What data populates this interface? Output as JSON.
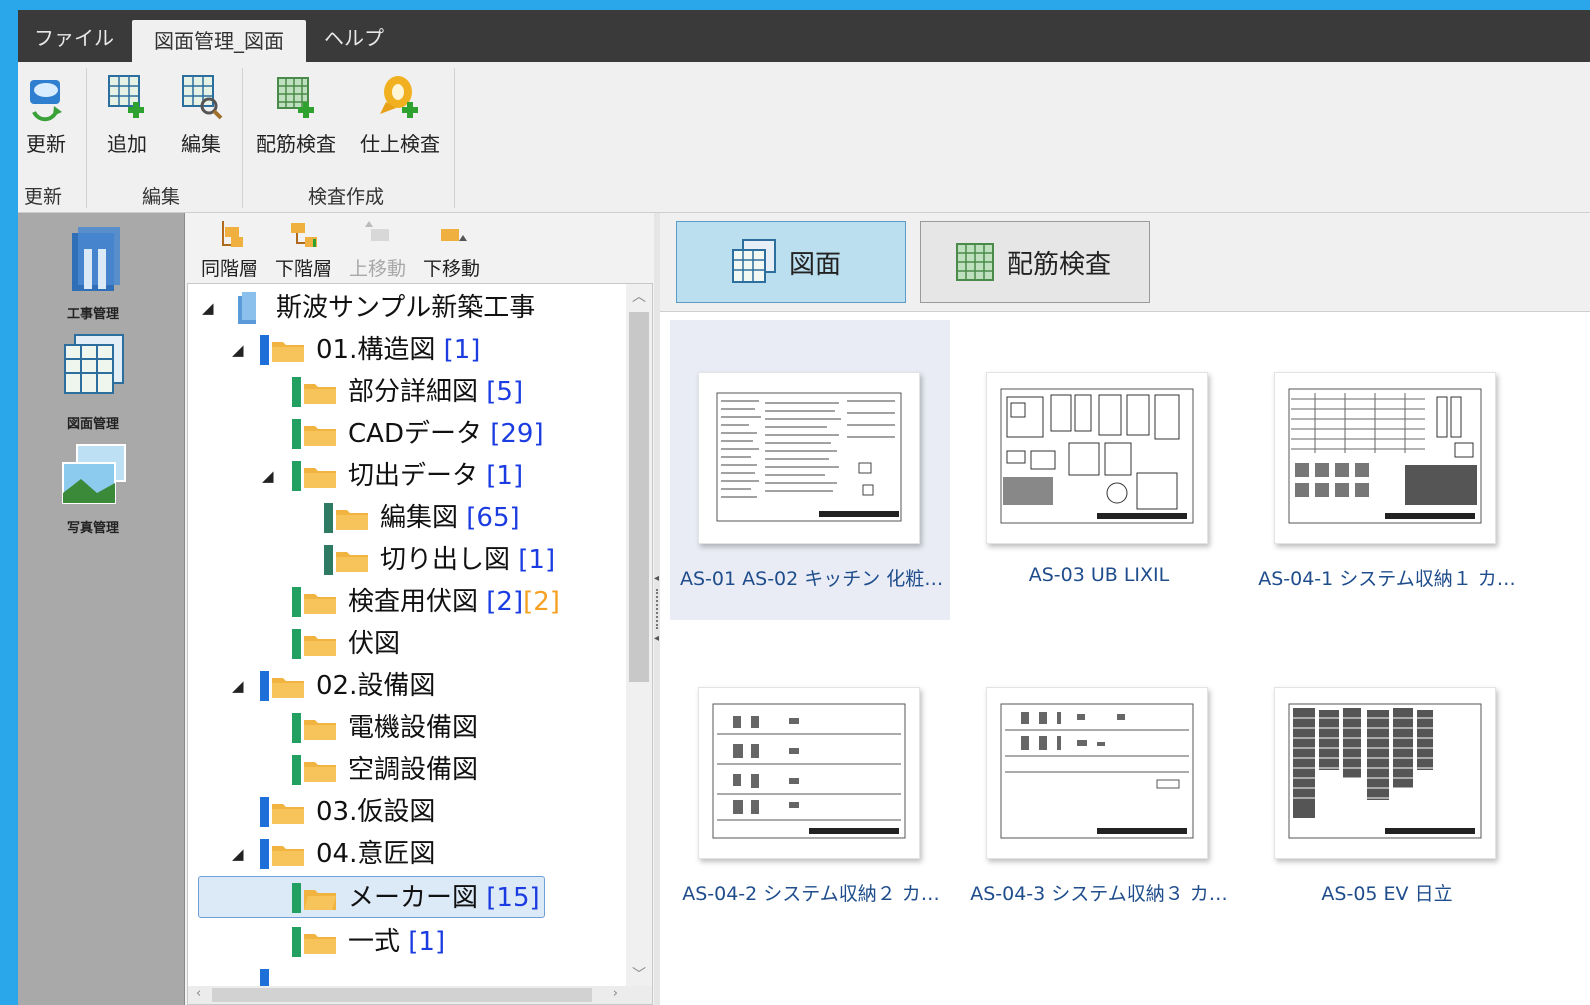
{
  "menu": {
    "items": [
      {
        "label": "ファイル",
        "active": false
      },
      {
        "label": "図面管理_図面",
        "active": true
      },
      {
        "label": "ヘルプ",
        "active": false
      }
    ]
  },
  "ribbon": {
    "buttons": {
      "refresh": "更新",
      "add": "追加",
      "edit": "編集",
      "rebar_inspection": "配筋検査",
      "finish_inspection": "仕上検査"
    },
    "groups": {
      "refresh": "更新",
      "edit": "編集",
      "inspection_create": "検査作成"
    }
  },
  "leftnav": {
    "items": [
      {
        "label": "工事管理",
        "icon": "construction-binder-icon"
      },
      {
        "label": "図面管理",
        "icon": "drawings-icon"
      },
      {
        "label": "写真管理",
        "icon": "photos-icon"
      }
    ]
  },
  "tree_toolbar": {
    "same_level": "同階層",
    "lower_level": "下階層",
    "move_up": "上移動",
    "move_down": "下移動"
  },
  "tree": {
    "root": "斯波サンプル新築工事",
    "nodes": [
      {
        "label": "01.構造図",
        "count": "[1]",
        "count2": ""
      },
      {
        "label": "部分詳細図",
        "count": "[5]",
        "count2": ""
      },
      {
        "label": "CADデータ",
        "count": "[29]",
        "count2": ""
      },
      {
        "label": "切出データ",
        "count": "[1]",
        "count2": ""
      },
      {
        "label": "編集図",
        "count": "[65]",
        "count2": ""
      },
      {
        "label": "切り出し図",
        "count": "[1]",
        "count2": ""
      },
      {
        "label": "検査用伏図",
        "count": "[2]",
        "count2": "[2]"
      },
      {
        "label": "伏図",
        "count": "",
        "count2": ""
      },
      {
        "label": "02.設備図",
        "count": "",
        "count2": ""
      },
      {
        "label": "電機設備図",
        "count": "",
        "count2": ""
      },
      {
        "label": "空調設備図",
        "count": "",
        "count2": ""
      },
      {
        "label": "03.仮設図",
        "count": "",
        "count2": ""
      },
      {
        "label": "04.意匠図",
        "count": "",
        "count2": ""
      },
      {
        "label": "メーカー図",
        "count": "[15]",
        "count2": ""
      },
      {
        "label": "一式",
        "count": "[1]",
        "count2": ""
      }
    ]
  },
  "content_tabs": {
    "drawings": "図面",
    "rebar_inspection": "配筋検査"
  },
  "drawings": [
    {
      "caption": "AS-01 AS-02 キッチン 化粧…"
    },
    {
      "caption": "AS-03 UB  LIXIL"
    },
    {
      "caption": "AS-04-1 システム収納１ カ…"
    },
    {
      "caption": "AS-04-2 システム収納２ カ…"
    },
    {
      "caption": "AS-04-3 システム収納３ カ…"
    },
    {
      "caption": "AS-05 EV 日立"
    }
  ],
  "colors": {
    "window_border": "#2aa6ea",
    "menubar": "#3a3a3a",
    "count_blue": "#1a3ce0",
    "count_orange": "#f5a020",
    "caption_blue": "#1f4d8c"
  }
}
